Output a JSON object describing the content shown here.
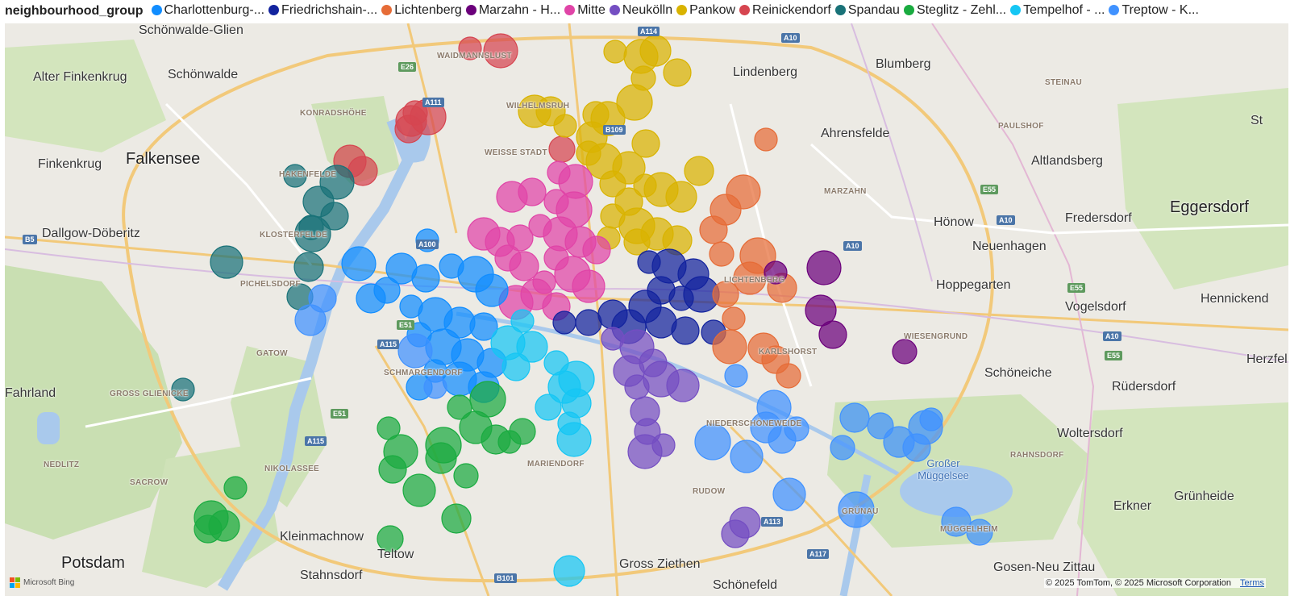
{
  "legend": {
    "title": "neighbourhood_group",
    "items": [
      {
        "label": "Charlottenburg-...",
        "color": "#118dff"
      },
      {
        "label": "Friedrichshain-...",
        "color": "#12239e"
      },
      {
        "label": "Lichtenberg",
        "color": "#e66c37"
      },
      {
        "label": "Marzahn - H...",
        "color": "#6b007b"
      },
      {
        "label": "Mitte",
        "color": "#e044a7"
      },
      {
        "label": "Neukölln",
        "color": "#744ec2"
      },
      {
        "label": "Pankow",
        "color": "#d9b300"
      },
      {
        "label": "Reinickendorf",
        "color": "#d64550"
      },
      {
        "label": "Spandau",
        "color": "#197278"
      },
      {
        "label": "Steglitz - Zehl...",
        "color": "#1aab40"
      },
      {
        "label": "Tempelhof - ...",
        "color": "#15c6f4"
      },
      {
        "label": "Treptow - K...",
        "color": "#4092ff"
      }
    ]
  },
  "places": [
    {
      "name": "Schönwalde-Glien",
      "size": "normal"
    },
    {
      "name": "Alter Finkenkrug",
      "size": "normal"
    },
    {
      "name": "Schönwalde",
      "size": "normal"
    },
    {
      "name": "Falkensee",
      "size": "big"
    },
    {
      "name": "Finkenkrug",
      "size": "normal"
    },
    {
      "name": "Dallgow-Döberitz",
      "size": "normal"
    },
    {
      "name": "Fahrland",
      "size": "normal"
    },
    {
      "name": "Potsdam",
      "size": "big"
    },
    {
      "name": "Kleinmachnow",
      "size": "normal"
    },
    {
      "name": "Teltow",
      "size": "normal"
    },
    {
      "name": "Stahnsdorf",
      "size": "normal"
    },
    {
      "name": "Gross Ziethen",
      "size": "normal"
    },
    {
      "name": "Schönefeld",
      "size": "normal"
    },
    {
      "name": "Lindenberg",
      "size": "normal"
    },
    {
      "name": "Blumberg",
      "size": "normal"
    },
    {
      "name": "Ahrensfelde",
      "size": "normal"
    },
    {
      "name": "Altlandsberg",
      "size": "normal"
    },
    {
      "name": "Eggersdorf",
      "size": "big"
    },
    {
      "name": "Hönow",
      "size": "normal"
    },
    {
      "name": "Fredersdorf",
      "size": "normal"
    },
    {
      "name": "Neuenhagen",
      "size": "normal"
    },
    {
      "name": "Hoppegarten",
      "size": "normal"
    },
    {
      "name": "Vogelsdorf",
      "size": "normal"
    },
    {
      "name": "Hennickend",
      "size": "normal"
    },
    {
      "name": "Herzfel",
      "size": "normal"
    },
    {
      "name": "Schöneiche",
      "size": "normal"
    },
    {
      "name": "Rüdersdorf",
      "size": "normal"
    },
    {
      "name": "Woltersdorf",
      "size": "normal"
    },
    {
      "name": "Erkner",
      "size": "normal"
    },
    {
      "name": "Grünheide",
      "size": "normal"
    },
    {
      "name": "Gosen-Neu Zittau",
      "size": "normal"
    },
    {
      "name": "St",
      "size": "normal"
    },
    {
      "name": "WAIDMANNSLUST",
      "size": "small"
    },
    {
      "name": "KONRADSHÖHE",
      "size": "small"
    },
    {
      "name": "WILHELMSRUH",
      "size": "small"
    },
    {
      "name": "WEISSE STADT",
      "size": "small"
    },
    {
      "name": "HAKENFELDE",
      "size": "small"
    },
    {
      "name": "KLOSTERFELDE",
      "size": "small"
    },
    {
      "name": "PICHELSDORF",
      "size": "small"
    },
    {
      "name": "GATOW",
      "size": "small"
    },
    {
      "name": "GROSS GLIENICKE",
      "size": "small"
    },
    {
      "name": "SCHMARGENDORF",
      "size": "small"
    },
    {
      "name": "NEDLITZ",
      "size": "small"
    },
    {
      "name": "SACROW",
      "size": "small"
    },
    {
      "name": "NIKOLASSEE",
      "size": "small"
    },
    {
      "name": "MARIENDORF",
      "size": "small"
    },
    {
      "name": "RUDOW",
      "size": "small"
    },
    {
      "name": "NIEDERSCHÖNEWEIDE",
      "size": "small"
    },
    {
      "name": "GRÜNAU",
      "size": "small"
    },
    {
      "name": "MÜGGELHEIM",
      "size": "small"
    },
    {
      "name": "RAHNSDORF",
      "size": "small"
    },
    {
      "name": "WIESENGRUND",
      "size": "small"
    },
    {
      "name": "MARZAHN",
      "size": "small"
    },
    {
      "name": "PAULSHOF",
      "size": "small"
    },
    {
      "name": "STEINAU",
      "size": "small"
    },
    {
      "name": "LICHTENBERG",
      "size": "small"
    },
    {
      "name": "KARLSHORST",
      "size": "small"
    }
  ],
  "water_labels": [
    {
      "name": "Großer Müggelsee"
    }
  ],
  "road_shields": [
    "A114",
    "A10",
    "E26",
    "A111",
    "B109",
    "B5",
    "A100",
    "E51",
    "A115",
    "E51",
    "A115",
    "A10",
    "A113",
    "A117",
    "B101",
    "E55",
    "A10",
    "E55",
    "A10",
    "E55"
  ],
  "attribution": {
    "logo_text": "Microsoft Bing",
    "copyright": "© 2025 TomTom, © 2025 Microsoft Corporation",
    "terms": "Terms"
  },
  "points": [
    {
      "group": "Reinickendorf",
      "coords": [
        [
          583,
          60
        ],
        [
          621,
          63
        ],
        [
          510,
          150
        ],
        [
          507,
          160
        ],
        [
          515,
          140
        ],
        [
          531,
          145
        ],
        [
          434,
          200
        ],
        [
          450,
          212
        ],
        [
          697,
          185
        ]
      ]
    },
    {
      "group": "Pankow",
      "coords": [
        [
          763,
          64
        ],
        [
          795,
          70
        ],
        [
          813,
          63
        ],
        [
          840,
          90
        ],
        [
          798,
          97
        ],
        [
          787,
          127
        ],
        [
          663,
          138
        ],
        [
          683,
          138
        ],
        [
          739,
          142
        ],
        [
          701,
          156
        ],
        [
          754,
          147
        ],
        [
          734,
          170
        ],
        [
          801,
          178
        ],
        [
          730,
          190
        ],
        [
          749,
          200
        ],
        [
          780,
          208
        ],
        [
          867,
          212
        ],
        [
          760,
          228
        ],
        [
          800,
          230
        ],
        [
          820,
          235
        ],
        [
          845,
          244
        ],
        [
          780,
          250
        ],
        [
          760,
          268
        ],
        [
          790,
          280
        ],
        [
          815,
          290
        ],
        [
          840,
          298
        ],
        [
          790,
          300
        ],
        [
          755,
          295
        ]
      ]
    },
    {
      "group": "Mitte",
      "coords": [
        [
          693,
          214
        ],
        [
          714,
          225
        ],
        [
          635,
          244
        ],
        [
          660,
          238
        ],
        [
          690,
          250
        ],
        [
          712,
          260
        ],
        [
          600,
          290
        ],
        [
          620,
          300
        ],
        [
          645,
          295
        ],
        [
          670,
          280
        ],
        [
          695,
          290
        ],
        [
          720,
          300
        ],
        [
          740,
          310
        ],
        [
          690,
          320
        ],
        [
          710,
          340
        ],
        [
          730,
          355
        ],
        [
          650,
          330
        ],
        [
          630,
          320
        ],
        [
          675,
          350
        ],
        [
          640,
          375
        ],
        [
          665,
          365
        ],
        [
          690,
          380
        ]
      ]
    },
    {
      "group": "Charlottenburg-Wilmersdorf",
      "coords": [
        [
          530,
          298
        ],
        [
          445,
          327
        ],
        [
          498,
          333
        ],
        [
          528,
          345
        ],
        [
          560,
          330
        ],
        [
          590,
          340
        ],
        [
          610,
          360
        ],
        [
          460,
          370
        ],
        [
          480,
          360
        ],
        [
          510,
          380
        ],
        [
          540,
          390
        ],
        [
          570,
          400
        ],
        [
          600,
          405
        ],
        [
          520,
          415
        ],
        [
          550,
          430
        ],
        [
          580,
          440
        ],
        [
          610,
          450
        ],
        [
          520,
          480
        ],
        [
          540,
          460
        ],
        [
          570,
          470
        ],
        [
          600,
          480
        ]
      ]
    },
    {
      "group": "Friedrichshain-Kreuzberg",
      "coords": [
        [
          805,
          325
        ],
        [
          830,
          330
        ],
        [
          860,
          340
        ],
        [
          820,
          360
        ],
        [
          845,
          370
        ],
        [
          870,
          365
        ],
        [
          800,
          380
        ],
        [
          760,
          390
        ],
        [
          730,
          400
        ],
        [
          700,
          400
        ],
        [
          780,
          405
        ],
        [
          820,
          400
        ],
        [
          850,
          410
        ],
        [
          885,
          412
        ]
      ]
    },
    {
      "group": "Tempelhof-Schöneberg",
      "coords": [
        [
          648,
          398
        ],
        [
          630,
          425
        ],
        [
          660,
          430
        ],
        [
          640,
          455
        ],
        [
          690,
          450
        ],
        [
          715,
          470
        ],
        [
          700,
          480
        ],
        [
          715,
          500
        ],
        [
          680,
          505
        ],
        [
          706,
          525
        ],
        [
          712,
          545
        ],
        [
          706,
          708
        ]
      ]
    },
    {
      "group": "Neukölln",
      "coords": [
        [
          760,
          420
        ],
        [
          790,
          430
        ],
        [
          780,
          460
        ],
        [
          810,
          450
        ],
        [
          790,
          480
        ],
        [
          820,
          470
        ],
        [
          847,
          478
        ],
        [
          800,
          510
        ],
        [
          803,
          535
        ],
        [
          823,
          552
        ],
        [
          800,
          560
        ],
        [
          924,
          648
        ],
        [
          912,
          662
        ]
      ]
    },
    {
      "group": "Lichtenberg",
      "coords": [
        [
          950,
          173
        ],
        [
          922,
          238
        ],
        [
          900,
          260
        ],
        [
          885,
          285
        ],
        [
          895,
          315
        ],
        [
          940,
          317
        ],
        [
          930,
          345
        ],
        [
          970,
          357
        ],
        [
          900,
          365
        ],
        [
          910,
          395
        ],
        [
          905,
          430
        ],
        [
          947,
          432
        ],
        [
          962,
          446
        ],
        [
          978,
          466
        ]
      ]
    },
    {
      "group": "Marzahn-Hellersdorf",
      "coords": [
        [
          962,
          338
        ],
        [
          1022,
          332
        ],
        [
          1018,
          385
        ],
        [
          1033,
          415
        ],
        [
          1122,
          436
        ]
      ]
    },
    {
      "group": "Spandau",
      "coords": [
        [
          366,
          218
        ],
        [
          418,
          226
        ],
        [
          395,
          250
        ],
        [
          415,
          268
        ],
        [
          386,
          282
        ],
        [
          388,
          290
        ],
        [
          281,
          325
        ],
        [
          383,
          331
        ],
        [
          372,
          368
        ],
        [
          227,
          483
        ]
      ]
    },
    {
      "group": "Steglitz-Zehlendorf",
      "coords": [
        [
          482,
          531
        ],
        [
          497,
          560
        ],
        [
          547,
          568
        ],
        [
          487,
          582
        ],
        [
          578,
          590
        ],
        [
          550,
          552
        ],
        [
          520,
          608
        ],
        [
          566,
          643
        ],
        [
          484,
          668
        ],
        [
          292,
          605
        ],
        [
          262,
          642
        ],
        [
          278,
          652
        ],
        [
          258,
          656
        ],
        [
          570,
          505
        ],
        [
          605,
          495
        ],
        [
          590,
          530
        ],
        [
          615,
          545
        ],
        [
          648,
          535
        ],
        [
          632,
          548
        ]
      ]
    },
    {
      "group": "Treptow-Köpenick",
      "coords": [
        [
          913,
          466
        ],
        [
          960,
          505
        ],
        [
          950,
          530
        ],
        [
          970,
          545
        ],
        [
          988,
          532
        ],
        [
          884,
          548
        ],
        [
          926,
          566
        ],
        [
          1060,
          518
        ],
        [
          1092,
          528
        ],
        [
          1155,
          520
        ],
        [
          1148,
          530
        ],
        [
          1115,
          548
        ],
        [
          1137,
          555
        ],
        [
          1045,
          555
        ],
        [
          1062,
          632
        ],
        [
          979,
          613
        ],
        [
          1186,
          647
        ],
        [
          1215,
          660
        ],
        [
          540,
          480
        ],
        [
          515,
          435
        ],
        [
          385,
          397
        ],
        [
          400,
          370
        ]
      ]
    }
  ]
}
